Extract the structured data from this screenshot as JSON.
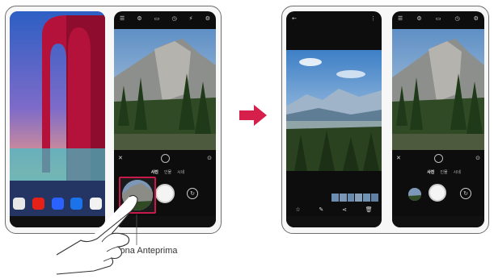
{
  "callout": {
    "label": "Icona Anteprima",
    "arrow_color": "#d61f4a",
    "highlight_color": "#c8194a"
  },
  "camera": {
    "modes": [
      "",
      "",
      "사진",
      "인물",
      "시네",
      ""
    ],
    "active_mode_index": 2,
    "zoom_label": "",
    "switch_icon": "camera-switch-icon"
  },
  "gallery": {
    "thumbnail_count": 6
  },
  "colors": {
    "device_outline": "#6d6d6d",
    "screen_bg": "#0d0d0d"
  }
}
